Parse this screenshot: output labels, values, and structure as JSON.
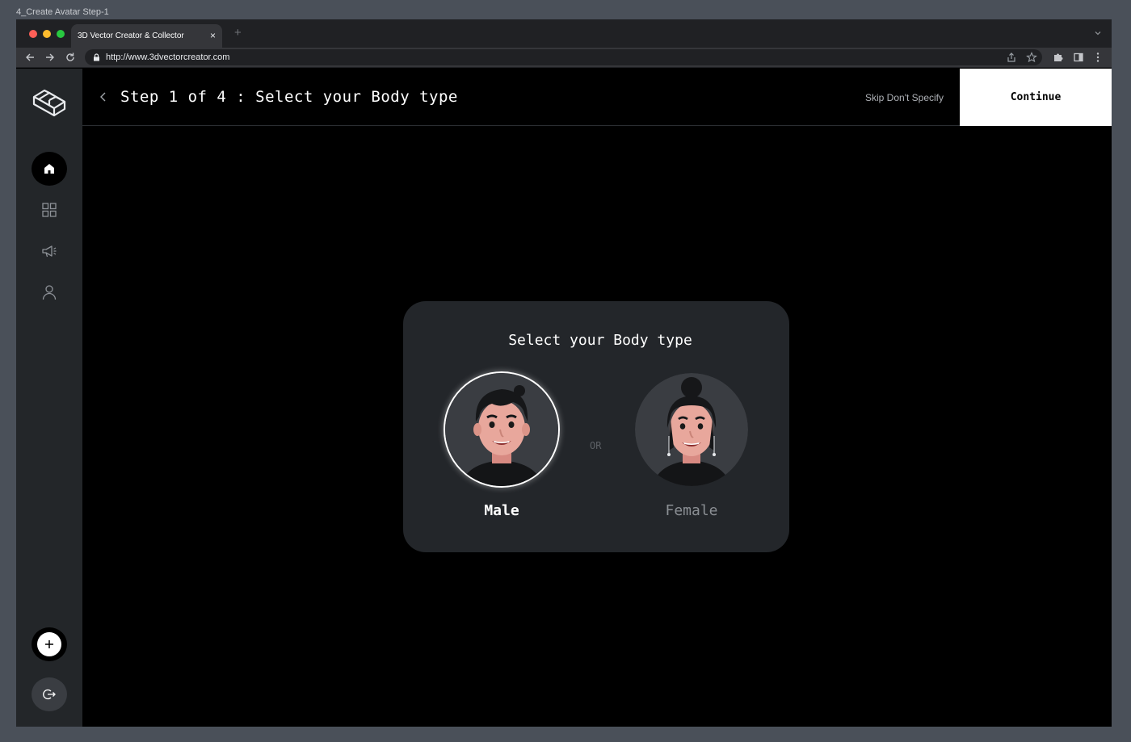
{
  "frame": {
    "title": "4_Create Avatar Step-1"
  },
  "browser": {
    "tab_title": "3D Vector Creator & Collector",
    "tab_close": "×",
    "new_tab": "+",
    "url": "http://www.3dvectorcreator.com",
    "traffic_lights": [
      "#ff5f57",
      "#febc2e",
      "#28c840"
    ]
  },
  "sidebar": {
    "items": [
      {
        "name": "home",
        "icon": "home-icon",
        "active": true
      },
      {
        "name": "dashboard",
        "icon": "grid-icon",
        "active": false
      },
      {
        "name": "announcements",
        "icon": "megaphone-icon",
        "active": false
      },
      {
        "name": "profile",
        "icon": "user-icon",
        "active": false
      }
    ],
    "add_icon": "plus-icon",
    "logout_icon": "logout-icon"
  },
  "header": {
    "title": "Step 1 of 4 : Select your Body type",
    "skip_label": "Skip Don't Specify",
    "continue_label": "Continue"
  },
  "card": {
    "title": "Select your Body type",
    "separator": "OR",
    "options": [
      {
        "label": "Male",
        "selected": true
      },
      {
        "label": "Female",
        "selected": false
      }
    ]
  },
  "colors": {
    "accent": "#ffffff",
    "sidebar_bg": "#232629",
    "card_bg": "#23262a",
    "page_bg": "#000000"
  }
}
